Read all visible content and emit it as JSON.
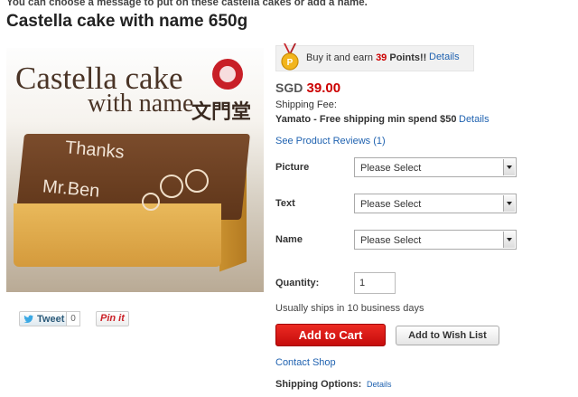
{
  "top_message": "You can choose a message to put on these castella cakes or add a name.",
  "product": {
    "title": "Castella cake with name 650g",
    "image": {
      "title_line1": "Castella cake",
      "title_line2": "with name",
      "brand_text": "文門堂",
      "cake_text_1": "Thanks",
      "cake_text_2": "Mr.Ben"
    }
  },
  "social": {
    "tweet_label": "Tweet",
    "tweet_count": "0",
    "pinit_label": "Pin it"
  },
  "points": {
    "prefix": "Buy it and earn",
    "value": "39",
    "suffix": "Points!!",
    "details": "Details"
  },
  "price": {
    "currency": "SGD",
    "amount": "39.00"
  },
  "shipping": {
    "fee_label": "Shipping Fee:",
    "method": "Yamato - Free shipping min spend $50",
    "details": "Details"
  },
  "reviews_link": "See Product Reviews (1)",
  "options": [
    {
      "label": "Picture",
      "selected": "Please Select"
    },
    {
      "label": "Text",
      "selected": "Please Select"
    },
    {
      "label": "Name",
      "selected": "Please Select"
    }
  ],
  "quantity": {
    "label": "Quantity:",
    "value": "1"
  },
  "ships_note": "Usually ships in 10 business days",
  "buttons": {
    "add_to_cart": "Add to Cart",
    "wish_list": "Add to Wish List"
  },
  "contact_shop": "Contact Shop",
  "shipping_options": {
    "label": "Shipping Options:",
    "details": "Details"
  },
  "colors": {
    "price_red": "#cc0000",
    "link_blue": "#1f62b0",
    "cart_red": "#e11b16"
  }
}
